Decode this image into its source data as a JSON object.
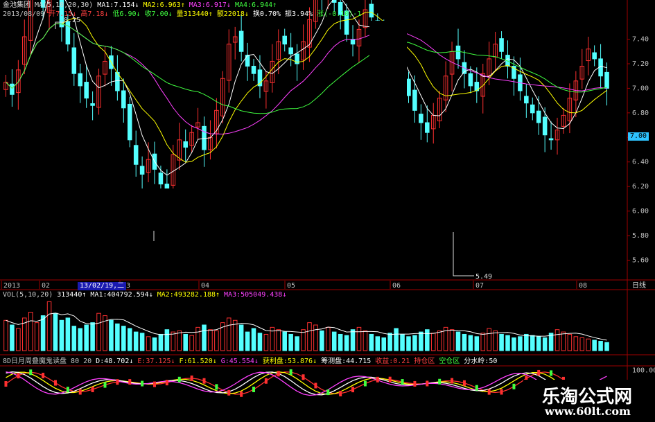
{
  "header": {
    "row1": [
      {
        "text": "金池集团",
        "color": "#e0e0e0"
      },
      {
        "text": "MA(5,10,20,30)",
        "color": "#d0d0d0"
      },
      {
        "text": "MA1:7.154↓",
        "color": "#ffffff"
      },
      {
        "text": "MA2:6.963↑",
        "color": "#ffff00"
      },
      {
        "text": "MA3:6.917↓",
        "color": "#ff40ff"
      },
      {
        "text": "MA4:6.944↑",
        "color": "#40ff40"
      }
    ],
    "row2": [
      {
        "text": "2013/08/09",
        "color": "#c0c0c0"
      },
      {
        "text": "开7.15↓",
        "color": "#ff4040"
      },
      {
        "text": "高7.18↓",
        "color": "#ff4040"
      },
      {
        "text": "低6.90↓",
        "color": "#40ff40"
      },
      {
        "text": "收7.00↓",
        "color": "#40ff40"
      },
      {
        "text": "量313440↑",
        "color": "#ffff00"
      },
      {
        "text": "额22018↓",
        "color": "#ffff00"
      },
      {
        "text": "换0.70%",
        "color": "#ffffff"
      },
      {
        "text": "振3.94%",
        "color": "#ffffff"
      },
      {
        "text": "涨(-0.10)-1",
        "color": "#40ff40"
      }
    ],
    "vol_row": [
      {
        "text": "VOL(5,10,20)",
        "color": "#d0d0d0"
      },
      {
        "text": "313440↑",
        "color": "#ffffff"
      },
      {
        "text": "MA1:404792.594↓",
        "color": "#ffffff"
      },
      {
        "text": "MA2:493282.188↑",
        "color": "#ffff00"
      },
      {
        "text": "MA3:505049.438↓",
        "color": "#ff40ff"
      }
    ],
    "ind_row": [
      {
        "text": "8D日月周叠魔鬼读盘 80 20",
        "color": "#c0c0c0"
      },
      {
        "text": "D:48.702↓",
        "color": "#ffffff"
      },
      {
        "text": "E:37.125↓",
        "color": "#ff4040"
      },
      {
        "text": "F:61.520↓",
        "color": "#ffff00"
      },
      {
        "text": "G:45.554↓",
        "color": "#ff40ff"
      },
      {
        "text": "获利盘:53.876↓",
        "color": "#ffff00"
      },
      {
        "text": "筹测盘:44.715",
        "color": "#ffffff"
      },
      {
        "text": "收益:0.21",
        "color": "#ff4040"
      },
      {
        "text": "持仓区",
        "color": "#ff4040"
      },
      {
        "text": "空仓区",
        "color": "#40ff40"
      },
      {
        "text": "分水岭:50",
        "color": "#ffffff"
      }
    ]
  },
  "labels": {
    "max_label": "8.25",
    "min_label": "5.49",
    "highlight_date": "13/02/19,二",
    "period_label": "日线",
    "current_price": "7.00",
    "watermark_cn": "乐淘公式网",
    "watermark_url": "www.60lt.com"
  },
  "colors": {
    "up": "#ff3030",
    "down": "#54ffff",
    "ma1": "#ffffff",
    "ma2": "#ffff00",
    "ma3": "#ff40ff",
    "ma4": "#40ff40",
    "axis": "#a00000"
  },
  "chart_data": [
    {
      "type": "candlestick",
      "title": "金池集团 日线",
      "price_axis": [
        5.6,
        5.8,
        6.0,
        6.2,
        6.4,
        6.6,
        6.8,
        7.0,
        7.2,
        7.4
      ],
      "ylim": [
        5.45,
        7.55
      ],
      "x_ticks": [
        "2013",
        "02",
        "03",
        "04",
        "05",
        "06",
        "07",
        "08"
      ],
      "close": [
        7.05,
        6.95,
        7.15,
        7.42,
        7.78,
        7.85,
        7.66,
        8.02,
        7.86,
        7.5,
        7.36,
        7.12,
        7.02,
        6.92,
        6.86,
        7.1,
        7.22,
        7.16,
        6.98,
        6.84,
        6.58,
        6.38,
        6.3,
        6.42,
        6.34,
        6.22,
        6.18,
        6.46,
        6.58,
        6.52,
        6.64,
        6.72,
        6.5,
        6.6,
        6.82,
        7.08,
        7.36,
        7.42,
        7.3,
        7.18,
        7.12,
        7.02,
        7.06,
        7.22,
        7.38,
        7.36,
        7.28,
        7.2,
        7.38,
        7.56,
        7.8,
        7.74,
        7.86,
        7.7,
        7.6,
        7.44,
        7.36,
        7.48,
        7.64,
        7.58,
        7.44,
        7.32,
        7.24,
        7.16,
        7.06,
        6.94,
        6.82,
        6.72,
        6.64,
        6.78,
        6.92,
        7.1,
        7.3,
        7.24,
        7.12,
        7.02,
        6.98,
        7.12,
        7.24,
        7.36,
        7.3,
        7.18,
        7.08,
        6.98,
        6.88,
        6.8,
        6.72,
        6.62,
        6.58,
        6.66,
        6.78,
        6.92,
        7.06,
        7.18,
        7.32,
        7.24,
        7.1,
        7.0
      ],
      "ma_series": [
        {
          "name": "MA1"
        },
        {
          "name": "MA2"
        },
        {
          "name": "MA3"
        },
        {
          "name": "MA4"
        }
      ]
    },
    {
      "type": "bar",
      "title": "VOL(5,10,20)",
      "y_ticks": [
        100000,
        200000
      ],
      "volume": [
        130,
        110,
        95,
        140,
        165,
        120,
        150,
        210,
        160,
        130,
        140,
        105,
        95,
        110,
        120,
        160,
        150,
        130,
        115,
        105,
        95,
        80,
        75,
        60,
        55,
        70,
        90,
        80,
        85,
        70,
        65,
        100,
        110,
        90,
        85,
        120,
        140,
        130,
        110,
        80,
        95,
        75,
        70,
        100,
        90,
        80,
        70,
        60,
        90,
        120,
        110,
        85,
        100,
        80,
        70,
        65,
        90,
        100,
        85,
        70,
        60,
        55,
        75,
        95,
        70,
        60,
        65,
        80,
        90,
        75,
        85,
        100,
        90,
        80,
        70,
        65,
        60,
        75,
        95,
        85,
        70,
        65,
        55,
        60,
        70,
        65,
        60,
        55,
        75,
        90,
        80,
        70,
        60,
        55,
        50,
        45,
        40,
        35
      ]
    },
    {
      "type": "line",
      "title": "8D日月周叠魔鬼读盘",
      "y_ticks": [
        50,
        100
      ],
      "ylim": [
        0,
        110
      ]
    }
  ]
}
